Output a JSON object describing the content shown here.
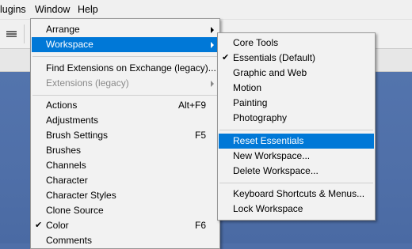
{
  "menubar": {
    "items": [
      {
        "label": "lugins"
      },
      {
        "label": "Window"
      },
      {
        "label": "Help"
      }
    ]
  },
  "window_menu": {
    "items": [
      {
        "label": "Arrange",
        "submenu": true
      },
      {
        "label": "Workspace",
        "submenu": true,
        "highlighted": true
      },
      {
        "label": "Find Extensions on Exchange (legacy)..."
      },
      {
        "label": "Extensions (legacy)",
        "submenu": true,
        "disabled": true
      },
      {
        "label": "Actions",
        "shortcut": "Alt+F9"
      },
      {
        "label": "Adjustments"
      },
      {
        "label": "Brush Settings",
        "shortcut": "F5"
      },
      {
        "label": "Brushes"
      },
      {
        "label": "Channels"
      },
      {
        "label": "Character"
      },
      {
        "label": "Character Styles"
      },
      {
        "label": "Clone Source"
      },
      {
        "label": "Color",
        "shortcut": "F6",
        "checked": true
      },
      {
        "label": "Comments"
      }
    ]
  },
  "workspace_submenu": {
    "items": [
      {
        "label": "Core Tools"
      },
      {
        "label": "Essentials (Default)",
        "checked": true
      },
      {
        "label": "Graphic and Web"
      },
      {
        "label": "Motion"
      },
      {
        "label": "Painting"
      },
      {
        "label": "Photography"
      },
      {
        "label": "Reset Essentials",
        "highlighted": true
      },
      {
        "label": "New Workspace..."
      },
      {
        "label": "Delete Workspace..."
      },
      {
        "label": "Keyboard Shortcuts & Menus..."
      },
      {
        "label": "Lock Workspace"
      }
    ]
  },
  "check_glyph": "✔",
  "colors": {
    "highlight": "#0078d7",
    "canvas": "#4f6fa8",
    "menu_bg": "#f2f2f2"
  }
}
